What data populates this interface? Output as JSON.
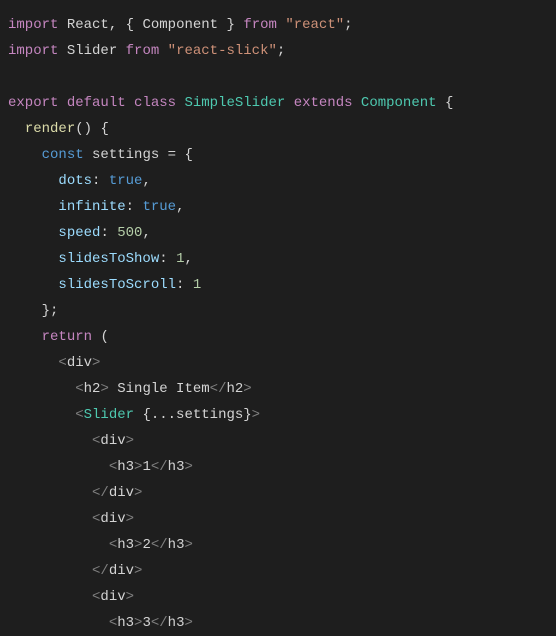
{
  "code": {
    "line1": {
      "kw_import": "import",
      "ident1": "React",
      "comma": ",",
      "brace_open": "{",
      "ident2": "Component",
      "brace_close": "}",
      "kw_from": "from",
      "str": "\"react\"",
      "semi": ";"
    },
    "line2": {
      "kw_import": "import",
      "ident1": "Slider",
      "kw_from": "from",
      "str": "\"react-slick\"",
      "semi": ";"
    },
    "line4": {
      "kw_export": "export",
      "kw_default": "default",
      "kw_class": "class",
      "classname": "SimpleSlider",
      "kw_extends": "extends",
      "supername": "Component",
      "brace": "{"
    },
    "line5": {
      "method": "render",
      "parens": "()",
      "brace": "{"
    },
    "line6": {
      "kw_const": "const",
      "ident": "settings",
      "eq": "=",
      "brace": "{"
    },
    "line7": {
      "prop": "dots",
      "colon": ":",
      "val": "true",
      "comma": ","
    },
    "line8": {
      "prop": "infinite",
      "colon": ":",
      "val": "true",
      "comma": ","
    },
    "line9": {
      "prop": "speed",
      "colon": ":",
      "val": "500",
      "comma": ","
    },
    "line10": {
      "prop": "slidesToShow",
      "colon": ":",
      "val": "1",
      "comma": ","
    },
    "line11": {
      "prop": "slidesToScroll",
      "colon": ":",
      "val": "1"
    },
    "line12": {
      "close": "};"
    },
    "line13": {
      "kw_return": "return",
      "paren": "("
    },
    "line14": {
      "open": "<",
      "tag": "div",
      "close": ">"
    },
    "line15": {
      "open1": "<",
      "tag1": "h2",
      "close1": ">",
      "text": " Single Item",
      "open2": "</",
      "tag2": "h2",
      "close2": ">"
    },
    "line16": {
      "open": "<",
      "tag": "Slider",
      "spread": "{...settings}",
      "close": ">"
    },
    "line17": {
      "open": "<",
      "tag": "div",
      "close": ">"
    },
    "line18": {
      "open1": "<",
      "tag1": "h3",
      "close1": ">",
      "text": "1",
      "open2": "</",
      "tag2": "h3",
      "close2": ">"
    },
    "line19": {
      "open": "</",
      "tag": "div",
      "close": ">"
    },
    "line20": {
      "open": "<",
      "tag": "div",
      "close": ">"
    },
    "line21": {
      "open1": "<",
      "tag1": "h3",
      "close1": ">",
      "text": "2",
      "open2": "</",
      "tag2": "h3",
      "close2": ">"
    },
    "line22": {
      "open": "</",
      "tag": "div",
      "close": ">"
    },
    "line23": {
      "open": "<",
      "tag": "div",
      "close": ">"
    },
    "line24": {
      "open1": "<",
      "tag1": "h3",
      "close1": ">",
      "text": "3",
      "open2": "</",
      "tag2": "h3",
      "close2": ">"
    }
  }
}
